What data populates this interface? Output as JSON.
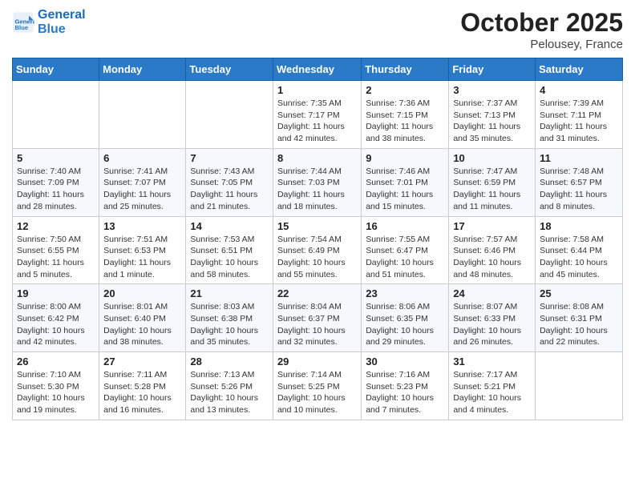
{
  "header": {
    "logo_line1": "General",
    "logo_line2": "Blue",
    "month": "October 2025",
    "location": "Pelousey, France"
  },
  "weekdays": [
    "Sunday",
    "Monday",
    "Tuesday",
    "Wednesday",
    "Thursday",
    "Friday",
    "Saturday"
  ],
  "weeks": [
    [
      {
        "day": "",
        "info": ""
      },
      {
        "day": "",
        "info": ""
      },
      {
        "day": "",
        "info": ""
      },
      {
        "day": "1",
        "info": "Sunrise: 7:35 AM\nSunset: 7:17 PM\nDaylight: 11 hours and 42 minutes."
      },
      {
        "day": "2",
        "info": "Sunrise: 7:36 AM\nSunset: 7:15 PM\nDaylight: 11 hours and 38 minutes."
      },
      {
        "day": "3",
        "info": "Sunrise: 7:37 AM\nSunset: 7:13 PM\nDaylight: 11 hours and 35 minutes."
      },
      {
        "day": "4",
        "info": "Sunrise: 7:39 AM\nSunset: 7:11 PM\nDaylight: 11 hours and 31 minutes."
      }
    ],
    [
      {
        "day": "5",
        "info": "Sunrise: 7:40 AM\nSunset: 7:09 PM\nDaylight: 11 hours and 28 minutes."
      },
      {
        "day": "6",
        "info": "Sunrise: 7:41 AM\nSunset: 7:07 PM\nDaylight: 11 hours and 25 minutes."
      },
      {
        "day": "7",
        "info": "Sunrise: 7:43 AM\nSunset: 7:05 PM\nDaylight: 11 hours and 21 minutes."
      },
      {
        "day": "8",
        "info": "Sunrise: 7:44 AM\nSunset: 7:03 PM\nDaylight: 11 hours and 18 minutes."
      },
      {
        "day": "9",
        "info": "Sunrise: 7:46 AM\nSunset: 7:01 PM\nDaylight: 11 hours and 15 minutes."
      },
      {
        "day": "10",
        "info": "Sunrise: 7:47 AM\nSunset: 6:59 PM\nDaylight: 11 hours and 11 minutes."
      },
      {
        "day": "11",
        "info": "Sunrise: 7:48 AM\nSunset: 6:57 PM\nDaylight: 11 hours and 8 minutes."
      }
    ],
    [
      {
        "day": "12",
        "info": "Sunrise: 7:50 AM\nSunset: 6:55 PM\nDaylight: 11 hours and 5 minutes."
      },
      {
        "day": "13",
        "info": "Sunrise: 7:51 AM\nSunset: 6:53 PM\nDaylight: 11 hours and 1 minute."
      },
      {
        "day": "14",
        "info": "Sunrise: 7:53 AM\nSunset: 6:51 PM\nDaylight: 10 hours and 58 minutes."
      },
      {
        "day": "15",
        "info": "Sunrise: 7:54 AM\nSunset: 6:49 PM\nDaylight: 10 hours and 55 minutes."
      },
      {
        "day": "16",
        "info": "Sunrise: 7:55 AM\nSunset: 6:47 PM\nDaylight: 10 hours and 51 minutes."
      },
      {
        "day": "17",
        "info": "Sunrise: 7:57 AM\nSunset: 6:46 PM\nDaylight: 10 hours and 48 minutes."
      },
      {
        "day": "18",
        "info": "Sunrise: 7:58 AM\nSunset: 6:44 PM\nDaylight: 10 hours and 45 minutes."
      }
    ],
    [
      {
        "day": "19",
        "info": "Sunrise: 8:00 AM\nSunset: 6:42 PM\nDaylight: 10 hours and 42 minutes."
      },
      {
        "day": "20",
        "info": "Sunrise: 8:01 AM\nSunset: 6:40 PM\nDaylight: 10 hours and 38 minutes."
      },
      {
        "day": "21",
        "info": "Sunrise: 8:03 AM\nSunset: 6:38 PM\nDaylight: 10 hours and 35 minutes."
      },
      {
        "day": "22",
        "info": "Sunrise: 8:04 AM\nSunset: 6:37 PM\nDaylight: 10 hours and 32 minutes."
      },
      {
        "day": "23",
        "info": "Sunrise: 8:06 AM\nSunset: 6:35 PM\nDaylight: 10 hours and 29 minutes."
      },
      {
        "day": "24",
        "info": "Sunrise: 8:07 AM\nSunset: 6:33 PM\nDaylight: 10 hours and 26 minutes."
      },
      {
        "day": "25",
        "info": "Sunrise: 8:08 AM\nSunset: 6:31 PM\nDaylight: 10 hours and 22 minutes."
      }
    ],
    [
      {
        "day": "26",
        "info": "Sunrise: 7:10 AM\nSunset: 5:30 PM\nDaylight: 10 hours and 19 minutes."
      },
      {
        "day": "27",
        "info": "Sunrise: 7:11 AM\nSunset: 5:28 PM\nDaylight: 10 hours and 16 minutes."
      },
      {
        "day": "28",
        "info": "Sunrise: 7:13 AM\nSunset: 5:26 PM\nDaylight: 10 hours and 13 minutes."
      },
      {
        "day": "29",
        "info": "Sunrise: 7:14 AM\nSunset: 5:25 PM\nDaylight: 10 hours and 10 minutes."
      },
      {
        "day": "30",
        "info": "Sunrise: 7:16 AM\nSunset: 5:23 PM\nDaylight: 10 hours and 7 minutes."
      },
      {
        "day": "31",
        "info": "Sunrise: 7:17 AM\nSunset: 5:21 PM\nDaylight: 10 hours and 4 minutes."
      },
      {
        "day": "",
        "info": ""
      }
    ]
  ]
}
